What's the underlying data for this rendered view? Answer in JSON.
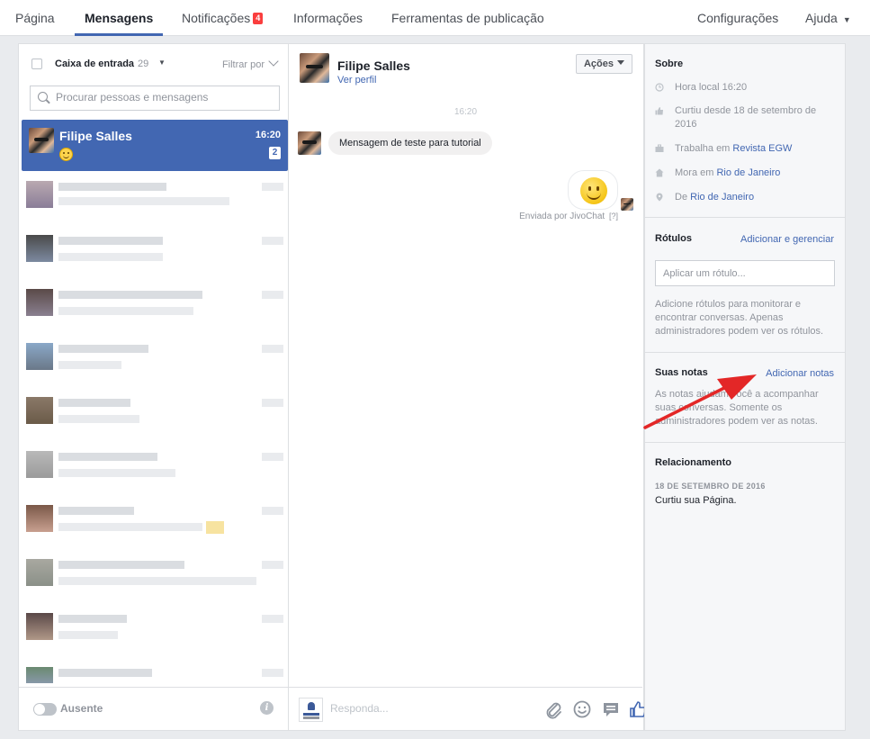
{
  "nav": {
    "tabs": [
      {
        "label": "Página"
      },
      {
        "label": "Mensagens"
      },
      {
        "label": "Notificações",
        "badge": "4"
      },
      {
        "label": "Informações"
      },
      {
        "label": "Ferramentas de publicação"
      }
    ],
    "settings": "Configurações",
    "help": "Ajuda"
  },
  "inbox": {
    "label": "Caixa de entrada",
    "count": "29",
    "filter": "Filtrar por",
    "search_placeholder": "Procurar pessoas e mensagens",
    "active_conversation": {
      "name": "Filipe Salles",
      "time": "16:20",
      "unread": "2",
      "emoji_icon": "smile-emoji-icon"
    },
    "footer": {
      "status": "Ausente"
    }
  },
  "conversation": {
    "name": "Filipe Salles",
    "profile_link": "Ver perfil",
    "actions": "Ações",
    "timestamp": "16:20",
    "incoming_message": "Mensagem de teste para tutorial",
    "sticker": "smile-sticker",
    "sent_by": "Enviada por JivoChat",
    "sent_by_help": "[?]",
    "reply_placeholder": "Responda..."
  },
  "sidebar": {
    "about": {
      "title": "Sobre",
      "local_time": "Hora local 16:20",
      "liked_since": "Curtiu desde 18 de setembro de 2016",
      "work_prefix": "Trabalha em",
      "work_place": "Revista EGW",
      "lives_prefix": "Mora em",
      "lives_place": "Rio de Janeiro",
      "from_prefix": "De",
      "from_place": "Rio de Janeiro"
    },
    "labels": {
      "title": "Rótulos",
      "manage": "Adicionar e gerenciar",
      "placeholder": "Aplicar um rótulo...",
      "help": "Adicione rótulos para monitorar e encontrar conversas. Apenas administradores podem ver os rótulos."
    },
    "notes": {
      "title": "Suas notas",
      "add": "Adicionar notas",
      "help": "As notas ajudam você a acompanhar suas conversas. Somente os administradores podem ver as notas."
    },
    "relationship": {
      "title": "Relacionamento",
      "date": "18 DE SETEMBRO DE 2016",
      "text": "Curtiu sua Página."
    }
  },
  "colors": {
    "accent": "#4267b2",
    "badge": "#fa3e3e",
    "annotation_arrow": "#e32727"
  }
}
